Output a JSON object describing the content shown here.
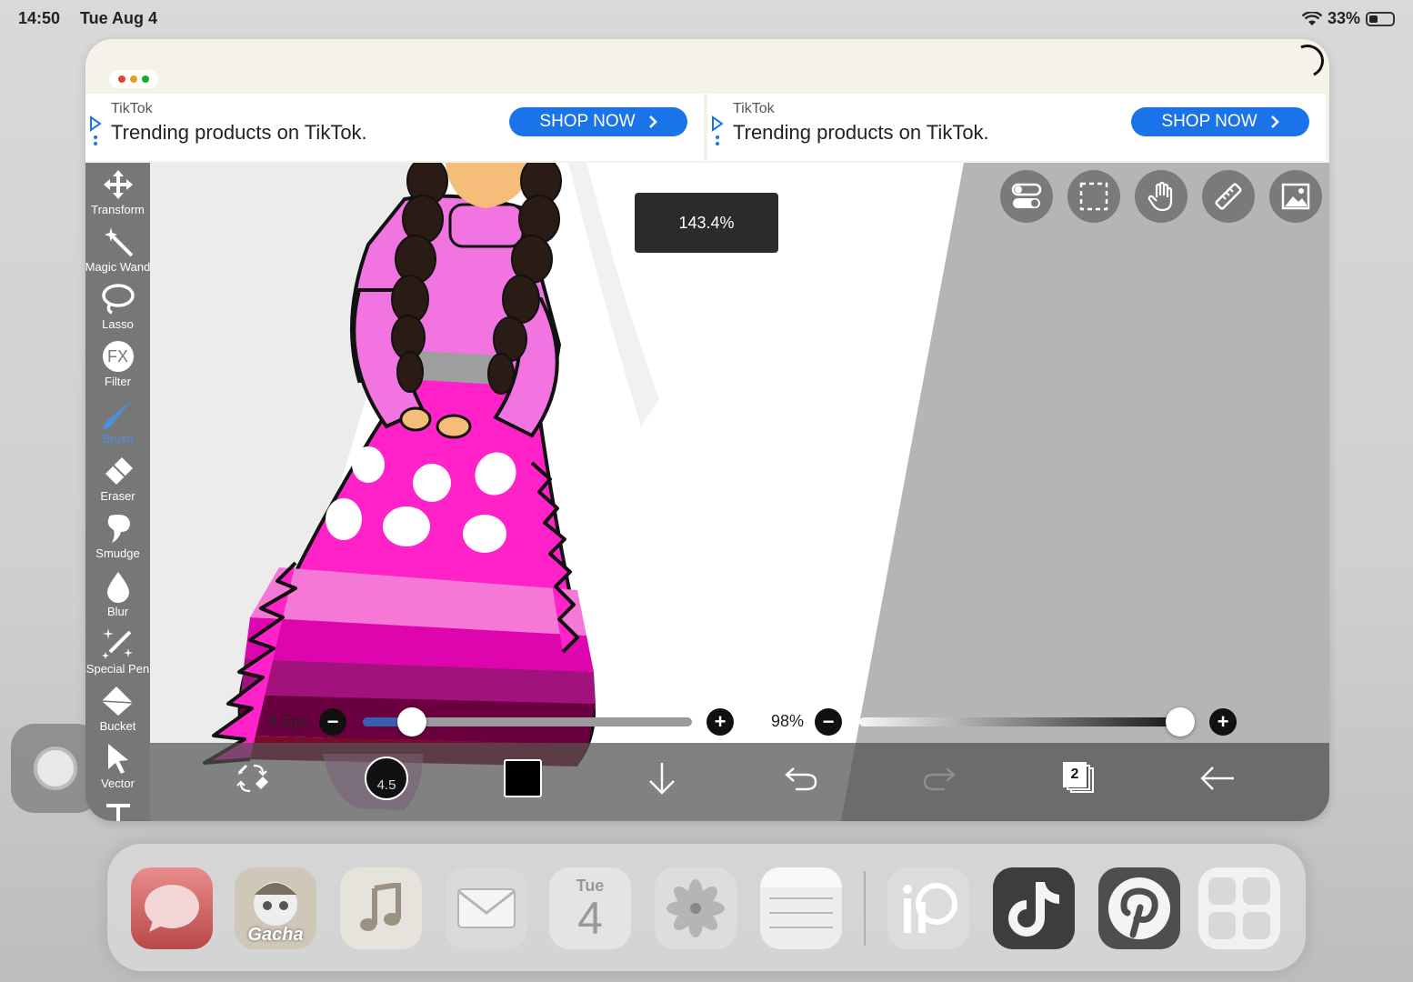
{
  "status_bar": {
    "time": "14:50",
    "date": "Tue Aug 4",
    "battery": "33%"
  },
  "ads": [
    {
      "source": "TikTok",
      "text": "Trending products on TikTok.",
      "button": "SHOP NOW"
    },
    {
      "source": "TikTok",
      "text": "Trending products on TikTok.",
      "button": "SHOP NOW"
    }
  ],
  "tools": [
    {
      "label": "Transform",
      "icon": "move-arrows-icon"
    },
    {
      "label": "Magic Wand",
      "icon": "magic-wand-icon"
    },
    {
      "label": "Lasso",
      "icon": "lasso-icon"
    },
    {
      "label": "Filter",
      "icon": "fx-icon",
      "glyph": "FX"
    },
    {
      "label": "Brush",
      "icon": "brush-icon",
      "active": true
    },
    {
      "label": "Eraser",
      "icon": "eraser-icon"
    },
    {
      "label": "Smudge",
      "icon": "smudge-icon"
    },
    {
      "label": "Blur",
      "icon": "drop-icon"
    },
    {
      "label": "Special Pen",
      "icon": "sparkle-pen-icon"
    },
    {
      "label": "Bucket",
      "icon": "bucket-icon"
    },
    {
      "label": "Vector",
      "icon": "cursor-icon"
    }
  ],
  "canvas": {
    "zoom": "143.4%"
  },
  "brush_size": {
    "label": "4.5px",
    "value_fraction": 0.15,
    "preview": "4.5"
  },
  "opacity": {
    "label": "98%",
    "value_fraction": 0.98
  },
  "layers": {
    "count": "2"
  },
  "colors": {
    "primary": "#000000",
    "accent": "#1a73e8",
    "active_tool": "#4a90e2"
  },
  "dock": {
    "calendar_day": "Tue",
    "calendar_date": "4",
    "gacha_label": "Gacha",
    "apps": [
      "messages-icon",
      "gacha-app-icon",
      "music-icon",
      "mail-icon",
      "calendar-icon",
      "photos-icon",
      "notes-icon",
      "ibispaint-icon",
      "tiktok-icon",
      "pinterest-icon",
      "app-library-icon"
    ]
  }
}
